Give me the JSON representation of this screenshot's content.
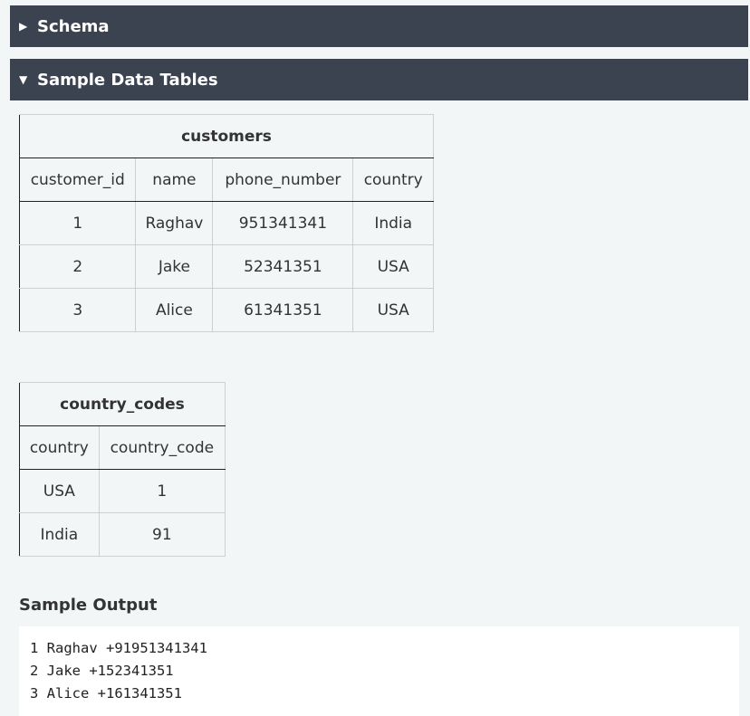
{
  "sections": {
    "schema": {
      "label": "Schema",
      "icon": "triangle-right-icon",
      "glyph": "▶"
    },
    "sample_tables": {
      "label": "Sample Data Tables",
      "icon": "triangle-down-icon",
      "glyph": "▼"
    }
  },
  "customers": {
    "title": "customers",
    "columns": [
      "customer_id",
      "name",
      "phone_number",
      "country"
    ],
    "rows": [
      [
        "1",
        "Raghav",
        "951341341",
        "India"
      ],
      [
        "2",
        "Jake",
        "52341351",
        "USA"
      ],
      [
        "3",
        "Alice",
        "61341351",
        "USA"
      ]
    ]
  },
  "country_codes": {
    "title": "country_codes",
    "columns": [
      "country",
      "country_code"
    ],
    "rows": [
      [
        "USA",
        "1"
      ],
      [
        "India",
        "91"
      ]
    ]
  },
  "sample_output": {
    "heading": "Sample Output",
    "lines": [
      "1 Raghav +91951341341",
      "2 Jake +152341351",
      "3 Alice +161341351"
    ]
  }
}
